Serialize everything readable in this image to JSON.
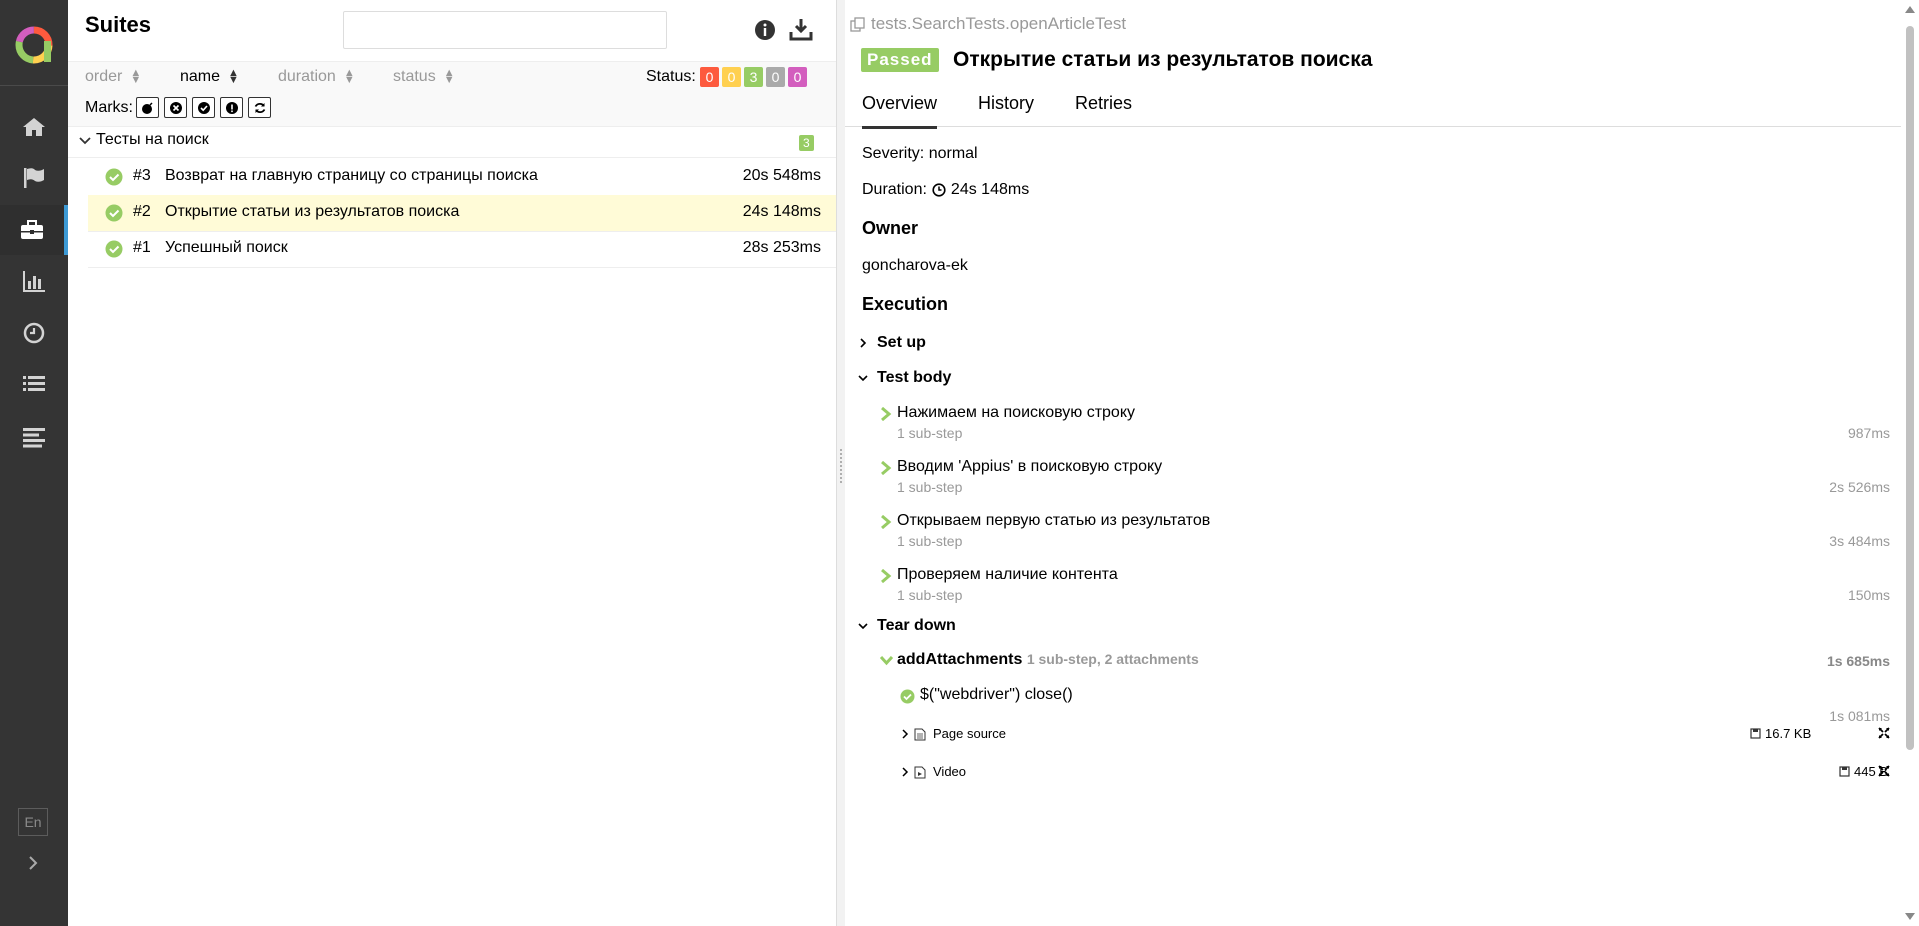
{
  "sidebar": {
    "items": [
      {
        "id": "overview",
        "icon": "home-icon"
      },
      {
        "id": "categories",
        "icon": "flag-icon"
      },
      {
        "id": "suites",
        "icon": "briefcase-icon",
        "active": true
      },
      {
        "id": "graphs",
        "icon": "bar-chart-icon"
      },
      {
        "id": "timeline",
        "icon": "clock-icon"
      },
      {
        "id": "behaviors",
        "icon": "list-icon"
      },
      {
        "id": "packages",
        "icon": "align-left-icon"
      }
    ],
    "lang": "En"
  },
  "suites": {
    "title": "Suites",
    "search_placeholder": "",
    "sort": {
      "order": "order",
      "name": "name",
      "duration": "duration",
      "status": "status"
    },
    "status_label": "Status:",
    "status_counts": [
      {
        "value": "0",
        "color": "#fd5a3e"
      },
      {
        "value": "0",
        "color": "#ffd050"
      },
      {
        "value": "3",
        "color": "#97cc64"
      },
      {
        "value": "0",
        "color": "#aaaaaa"
      },
      {
        "value": "0",
        "color": "#d35ebe"
      }
    ],
    "marks_label": "Marks:",
    "group": {
      "name": "Тесты на поиск",
      "count": "3"
    },
    "rows": [
      {
        "num": "#3",
        "name": "Возврат на главную страницу со страницы поиска",
        "duration": "20s 548ms"
      },
      {
        "num": "#2",
        "name": "Открытие статьи из результатов поиска",
        "duration": "24s 148ms",
        "selected": true
      },
      {
        "num": "#1",
        "name": "Успешный поиск",
        "duration": "28s 253ms"
      }
    ]
  },
  "test": {
    "full_name": "tests.SearchTests.openArticleTest",
    "status": "Passed",
    "status_color": "#97cc64",
    "title": "Открытие статьи из результатов поиска",
    "tabs": [
      "Overview",
      "History",
      "Retries"
    ],
    "severity": "Severity: normal",
    "duration_label": "Duration:",
    "duration": "24s 148ms",
    "owner_heading": "Owner",
    "owner": "goncharova-ek",
    "execution_heading": "Execution",
    "setup": "Set up",
    "test_body": "Test body",
    "steps": [
      {
        "title": "Нажимаем на поисковую строку",
        "sub": "1 sub-step",
        "duration": "987ms"
      },
      {
        "title": "Вводим 'Appius' в поисковую строку",
        "sub": "1 sub-step",
        "duration": "2s 526ms"
      },
      {
        "title": "Открываем первую статью из результатов",
        "sub": "1 sub-step",
        "duration": "3s 484ms"
      },
      {
        "title": "Проверяем наличие контента",
        "sub": "1 sub-step",
        "duration": "150ms"
      }
    ],
    "teardown": "Tear down",
    "add_attachments": {
      "title": "addAttachments",
      "meta": "1 sub-step, 2 attachments",
      "duration": "1s 685ms"
    },
    "substep": {
      "title": "$(\"webdriver\") close()",
      "duration": "1s 081ms"
    },
    "attachments": [
      {
        "name": "Page source",
        "size": "16.7 KB"
      },
      {
        "name": "Video",
        "size": "445 B"
      }
    ]
  }
}
